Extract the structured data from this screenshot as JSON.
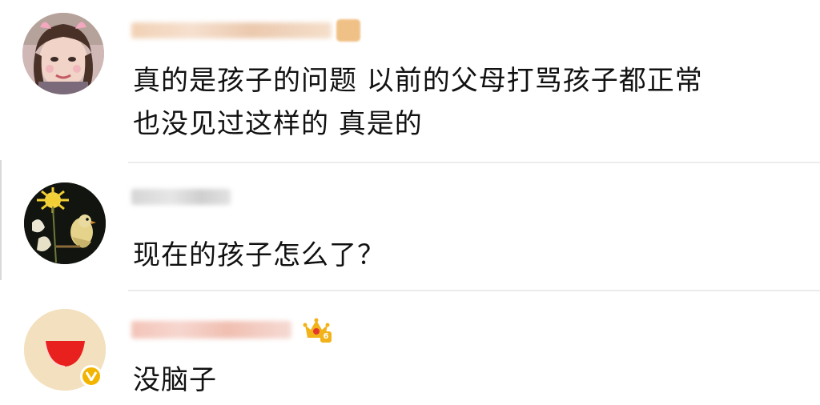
{
  "comments": [
    {
      "username": "",
      "text_lines": [
        "真的是孩子的问题  以前的父母打骂孩子都正常",
        "也没见过这样的 真是的"
      ],
      "avatar": "woman-selfie-avatar",
      "badge": "level-badge"
    },
    {
      "username": "",
      "text_lines": [
        "现在的孩子怎么了？"
      ],
      "avatar": "flower-bird-avatar",
      "badge": ""
    },
    {
      "username": "",
      "text_lines": [
        "没脑子"
      ],
      "avatar": "watermelon-avatar",
      "badge": "crown-badge",
      "badge_level": "6",
      "verified": "verified-v-icon"
    }
  ],
  "colors": {
    "divider": "#ececec",
    "crown": "#f2b31a",
    "verified": "#f3b400",
    "watermelon": "#e8201e"
  }
}
